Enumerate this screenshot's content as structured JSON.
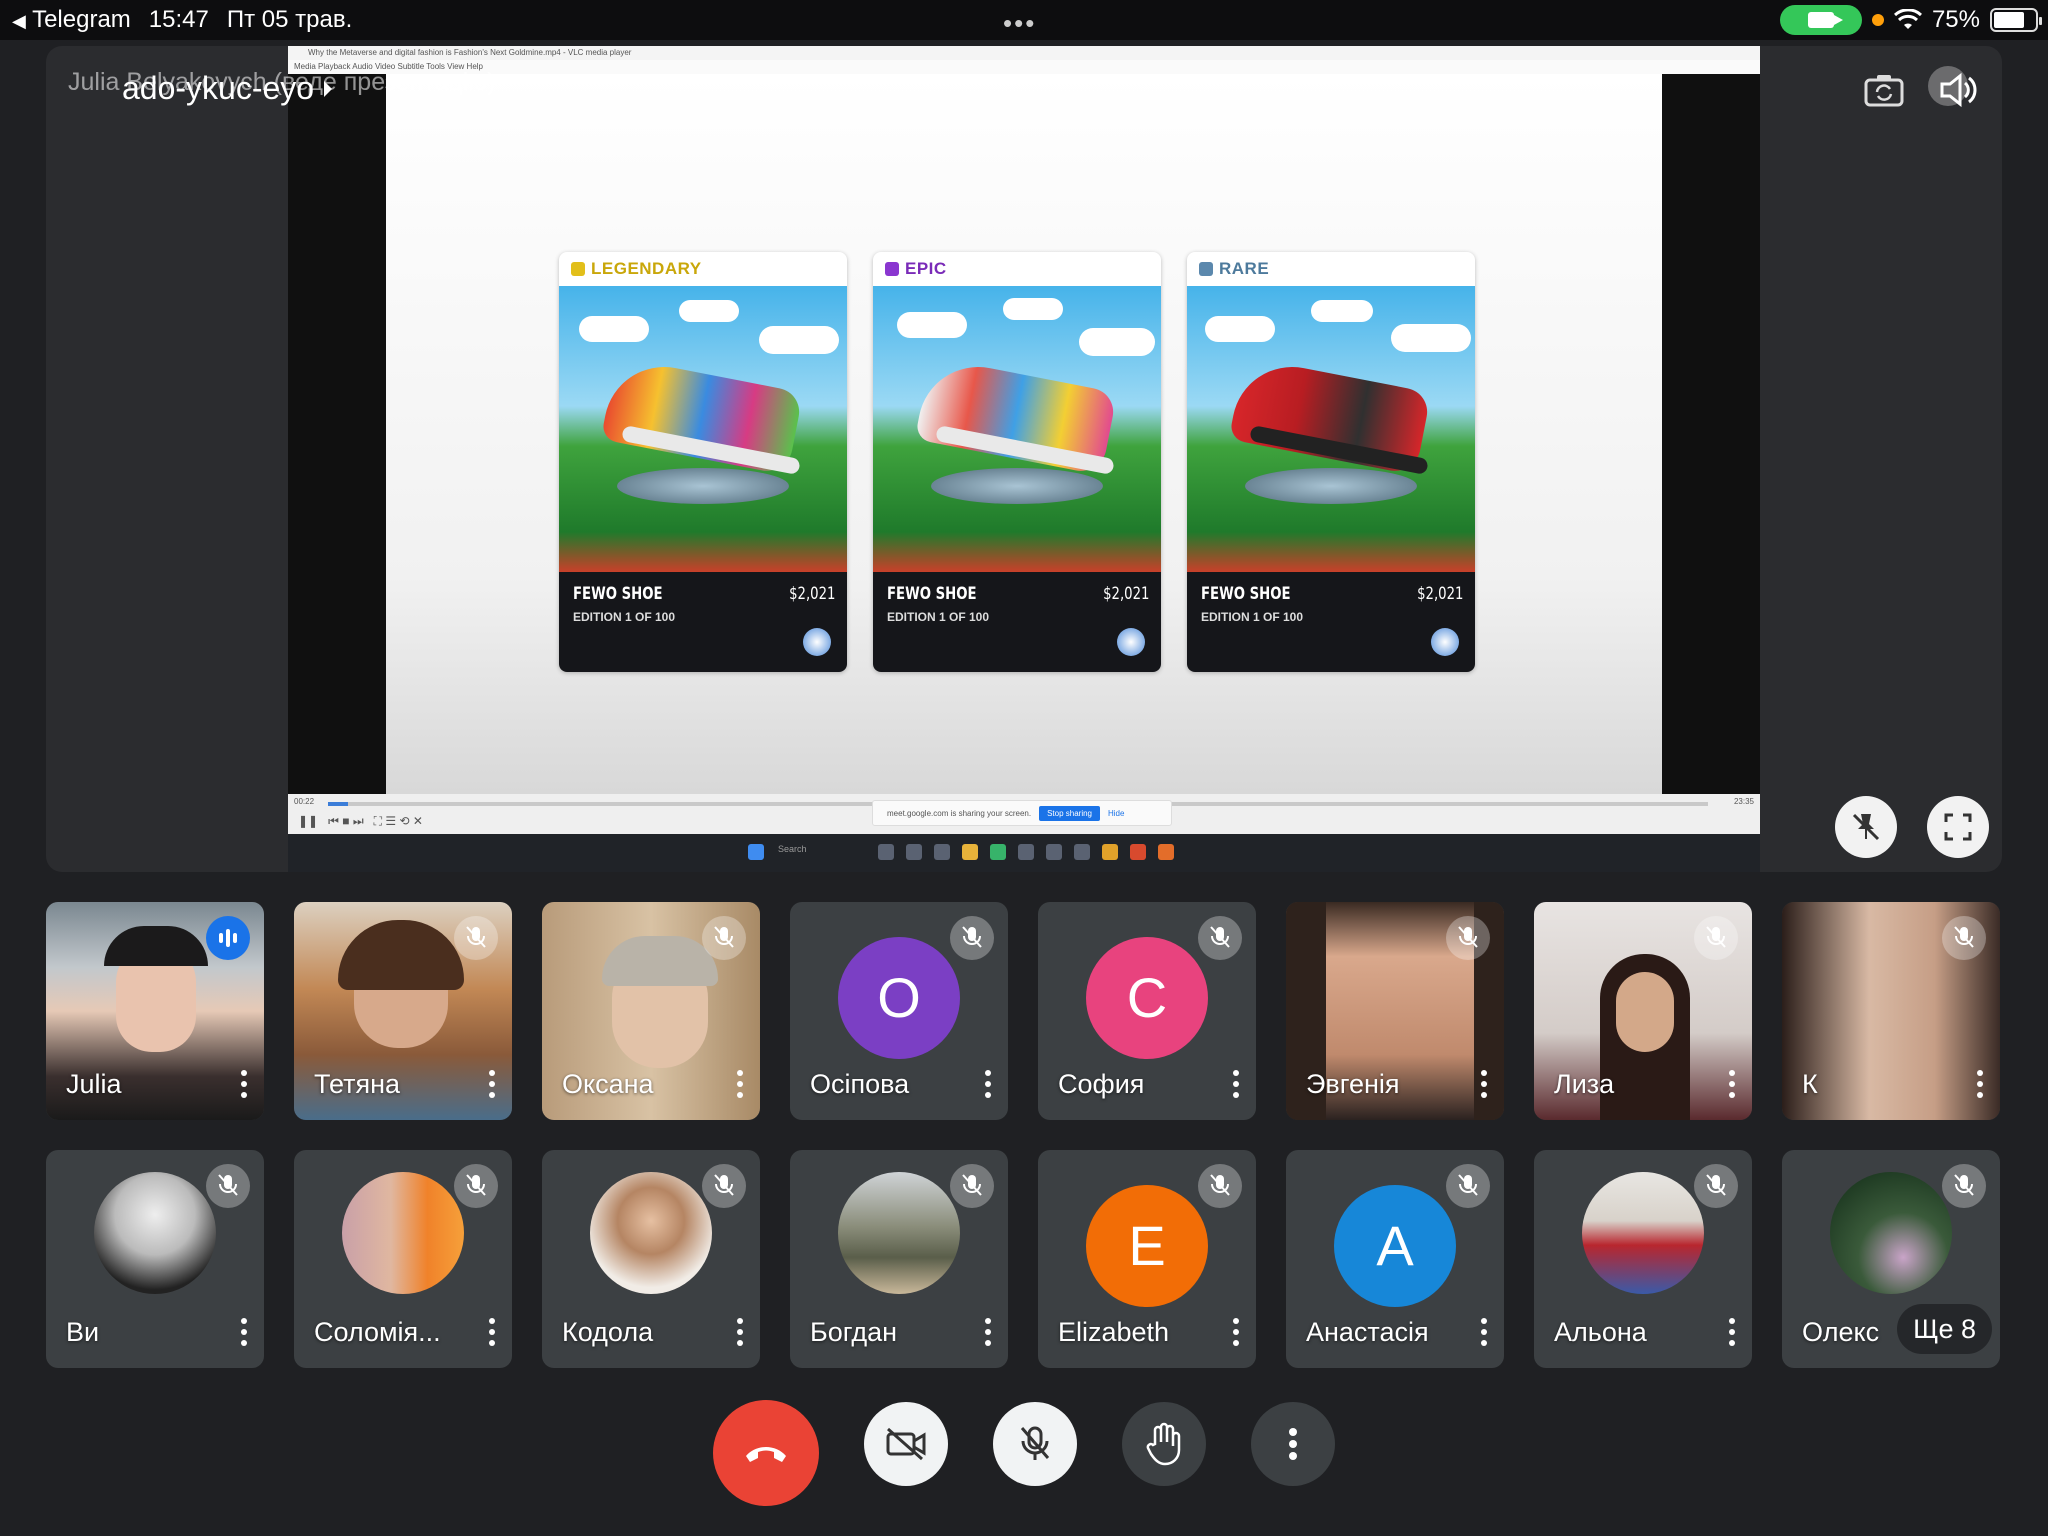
{
  "status_bar": {
    "back_app": "Telegram",
    "time": "15:47",
    "date": "Пт 05 трав.",
    "battery": "75%",
    "battery_level": 0.75
  },
  "presentation": {
    "presenter_label": "Julia Belyakovych (веде презентацію)",
    "meeting_code": "ado-ykuc-eyo",
    "vlc_title": "Why the Metaverse and digital fashion is Fashion's Next Goldmine.mp4 - VLC media player",
    "vlc_menu": "Media   Playback   Audio   Video   Subtitle   Tools   View   Help",
    "time_elapsed": "00:22",
    "time_total": "23:35",
    "share_text": "meet.google.com is sharing your screen.",
    "stop_sharing": "Stop sharing",
    "hide": "Hide",
    "taskbar_search": "Search",
    "cards": [
      {
        "rarity": "LEGENDARY",
        "rarity_color": "#c9a70a",
        "name": "FEWO SHOE",
        "price": "$2,021",
        "edition": "EDITION 1 OF 100"
      },
      {
        "rarity": "EPIC",
        "rarity_color": "#7a2bb8",
        "name": "FEWO SHOE",
        "price": "$2,021",
        "edition": "EDITION 1 OF 100"
      },
      {
        "rarity": "RARE",
        "rarity_color": "#4d7a9c",
        "name": "FEWO SHOE",
        "price": "$2,021",
        "edition": "EDITION 1 OF 100"
      }
    ]
  },
  "participants_row1": [
    {
      "name": "Julia",
      "type": "video",
      "speaking": true
    },
    {
      "name": "Тетяна",
      "type": "video"
    },
    {
      "name": "Оксана",
      "type": "video"
    },
    {
      "name": "Осіпова",
      "type": "letter",
      "letter": "О",
      "color": "#7b3fc4"
    },
    {
      "name": "София",
      "type": "letter",
      "letter": "С",
      "color": "#e8437e"
    },
    {
      "name": "Эвгенія",
      "type": "video"
    },
    {
      "name": "Лиза",
      "type": "video"
    },
    {
      "name": "К",
      "type": "video"
    }
  ],
  "participants_row2": [
    {
      "name": "Ви",
      "type": "avatar"
    },
    {
      "name": "Соломія...",
      "type": "avatar"
    },
    {
      "name": "Кодола",
      "type": "avatar"
    },
    {
      "name": "Богдан",
      "type": "avatar"
    },
    {
      "name": "Elizabeth",
      "type": "letter",
      "letter": "E",
      "color": "#f26d06"
    },
    {
      "name": "Анастасія",
      "type": "letter",
      "letter": "A",
      "color": "#1787d8"
    },
    {
      "name": "Альона",
      "type": "avatar"
    },
    {
      "name": "Олекс",
      "type": "avatar",
      "more_label": "Ще 8"
    }
  ],
  "controls": {
    "end_call": "end-call",
    "camera": "camera-off",
    "mic": "mic-off",
    "raise_hand": "raise-hand",
    "more": "more-options"
  }
}
